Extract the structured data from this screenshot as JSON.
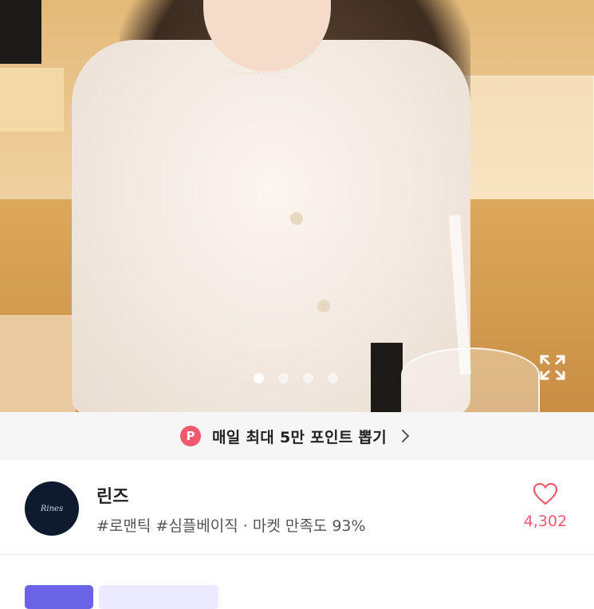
{
  "carousel": {
    "image_alt": "product-photo",
    "total_slides": 4,
    "active_index": 0,
    "expand_icon": "expand-icon"
  },
  "banner": {
    "badge": "P",
    "text": "매일 최대 5만 포인트 뽑기",
    "chevron_icon": "chevron-right-icon"
  },
  "shop": {
    "avatar_text": "Rines",
    "name": "린즈",
    "tags": "#로맨틱 #심플베이직 · 마켓 만족도 93%",
    "like_icon": "heart-icon",
    "likes": "4,302"
  },
  "tags_row": {
    "tag1": "",
    "tag2": ""
  },
  "colors": {
    "accent": "#f0586d",
    "purple": "#6b63e6",
    "banner_bg": "#f6f6f6"
  }
}
